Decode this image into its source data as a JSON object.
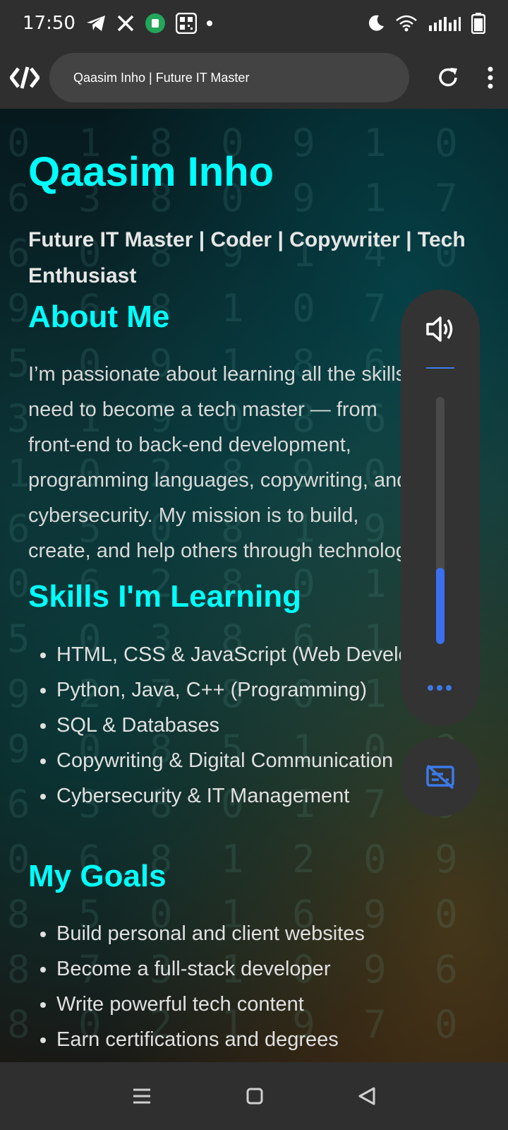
{
  "status": {
    "time": "17:50",
    "left_icons": [
      "telegram-icon",
      "x-icon",
      "app-icon",
      "qr-icon"
    ],
    "right_icons": [
      "moon-icon",
      "wifi-icon",
      "signal-icon",
      "battery-icon"
    ]
  },
  "browser": {
    "url_title": "Qaasim Inho | Future IT Master"
  },
  "page": {
    "name": "Qaasim Inho",
    "tagline": "Future IT Master | Coder | Copywriter | Tech Enthusiast",
    "about_heading": "About Me",
    "about_text": "I’m passionate about learning all the skills I need to become a tech master — from front-end to back-end development, programming languages, copywriting, and cybersecurity. My mission is to build, create, and help others through technology.",
    "skills_heading": "Skills I'm Learning",
    "skills": [
      "HTML, CSS & JavaScript (Web Development)",
      "Python, Java, C++ (Programming)",
      "SQL & Databases",
      "Copywriting & Digital Communication",
      "Cybersecurity & IT Management"
    ],
    "goals_heading": "My Goals",
    "goals": [
      "Build personal and client websites",
      "Become a full-stack developer",
      "Write powerful tech content",
      "Earn certifications and degrees"
    ]
  },
  "volume": {
    "level_percent": 31
  },
  "colors": {
    "accent": "#00ffff",
    "panel_accent": "#3b6ff0"
  }
}
